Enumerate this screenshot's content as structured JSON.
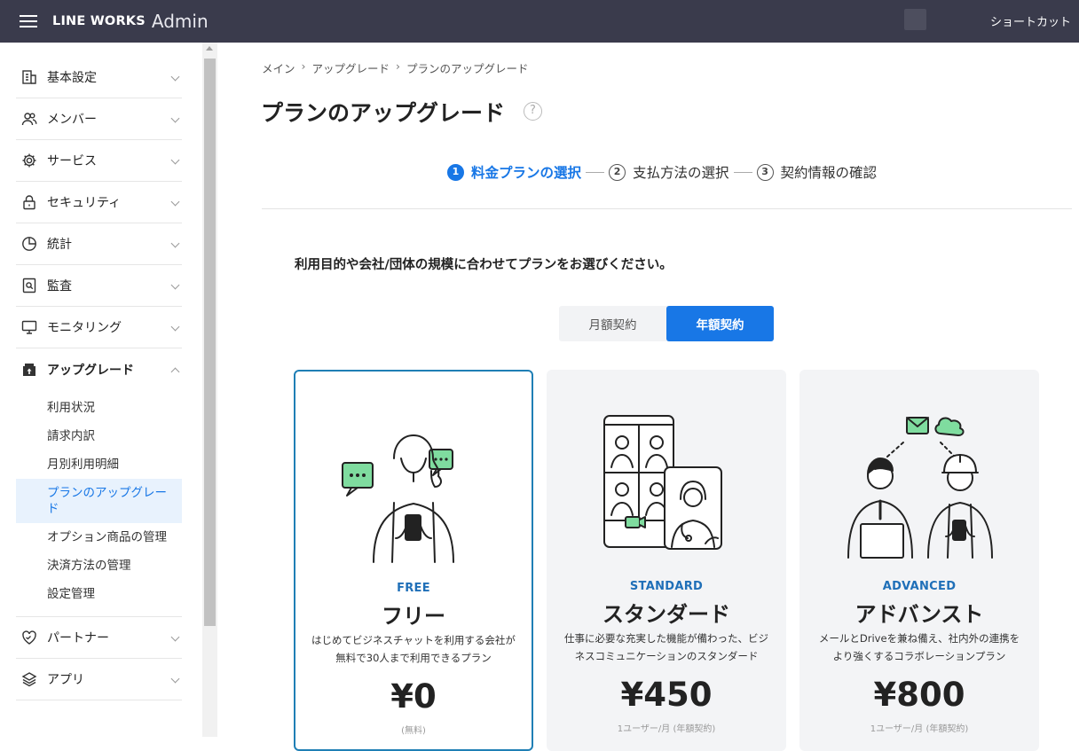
{
  "header": {
    "brand": "LINE WORKS",
    "brand_sub": "Admin",
    "shortcut": "ショートカット"
  },
  "sidebar": {
    "items": [
      {
        "label": "基本設定",
        "icon": "building-icon"
      },
      {
        "label": "メンバー",
        "icon": "members-icon"
      },
      {
        "label": "サービス",
        "icon": "gear-icon"
      },
      {
        "label": "セキュリティ",
        "icon": "lock-icon"
      },
      {
        "label": "統計",
        "icon": "pie-chart-icon"
      },
      {
        "label": "監査",
        "icon": "audit-search-icon"
      },
      {
        "label": "モニタリング",
        "icon": "monitor-icon"
      },
      {
        "label": "アップグレード",
        "icon": "upgrade-icon"
      }
    ],
    "upgrade_sub": [
      "利用状況",
      "請求内訳",
      "月別利用明細",
      "プランのアップグレード",
      "オプション商品の管理",
      "決済方法の管理",
      "設定管理"
    ],
    "items_after": [
      {
        "label": "パートナー",
        "icon": "partner-icon"
      },
      {
        "label": "アプリ",
        "icon": "layers-icon"
      }
    ]
  },
  "breadcrumb": [
    "メイン",
    "アップグレード",
    "プランのアップグレード"
  ],
  "page_title": "プランのアップグレード",
  "help": "?",
  "steps": [
    {
      "num": "1",
      "label": "料金プランの選択"
    },
    {
      "num": "2",
      "label": "支払方法の選択"
    },
    {
      "num": "3",
      "label": "契約情報の確認"
    }
  ],
  "instruction": "利用目的や会社/団体の規模に合わせてプランをお選びください。",
  "billing_toggle": {
    "monthly": "月額契約",
    "annual": "年額契約",
    "selected": "annual"
  },
  "plans": [
    {
      "tier": "FREE",
      "name": "フリー",
      "desc": "はじめてビジネスチャットを利用する会社が無料で30人まで利用できるプラン",
      "price": "¥0",
      "unit": "(無料)"
    },
    {
      "tier": "STANDARD",
      "name": "スタンダード",
      "desc": "仕事に必要な充実した機能が備わった、ビジネスコミュニケーションのスタンダード",
      "price": "¥450",
      "unit": "1ユーザー/月 (年額契約)"
    },
    {
      "tier": "ADVANCED",
      "name": "アドバンスト",
      "desc": "メールとDriveを兼ね備え、社内外の連携をより強くするコラボレーションプラン",
      "price": "¥800",
      "unit": "1ユーザー/月 (年額契約)"
    }
  ],
  "colors": {
    "header_bg": "#3a3b4c",
    "accent": "#1877e6",
    "tier": "#1f6fb8",
    "illus_green": "#7fdc9f"
  }
}
